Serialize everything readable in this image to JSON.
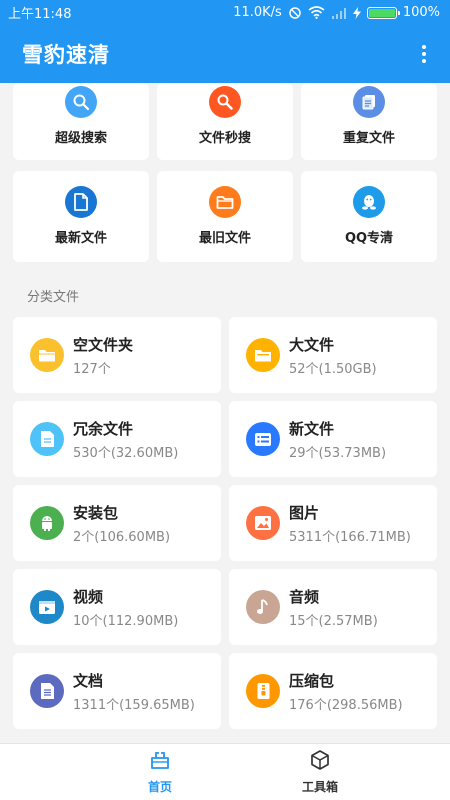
{
  "status_bar": {
    "time": "上午11:48",
    "speed": "11.0K/s",
    "battery": "100%"
  },
  "app_bar": {
    "title": "雪豹速清"
  },
  "tools": [
    {
      "label": "超级搜索",
      "icon": "search-icon",
      "color": "#42a5f5"
    },
    {
      "label": "文件秒搜",
      "icon": "magnifier-icon",
      "color": "#ff5722"
    },
    {
      "label": "重复文件",
      "icon": "duplicate-file-icon",
      "color": "#5c8ee6"
    },
    {
      "label": "最新文件",
      "icon": "file-icon",
      "color": "#1976d2"
    },
    {
      "label": "最旧文件",
      "icon": "folder-icon",
      "color": "#ff7b1c"
    },
    {
      "label": "QQ专清",
      "icon": "qq-icon",
      "color": "#1e9be9"
    }
  ],
  "section": {
    "title": "分类文件"
  },
  "categories": [
    {
      "name": "空文件夹",
      "count": "127个",
      "icon": "folder-icon",
      "color": "#fbc02d"
    },
    {
      "name": "大文件",
      "count": "52个(1.50GB)",
      "icon": "folder-icon",
      "color": "#ffb300"
    },
    {
      "name": "冗余文件",
      "count": "530个(32.60MB)",
      "icon": "document-icon",
      "color": "#4fc3f7"
    },
    {
      "name": "新文件",
      "count": "29个(53.73MB)",
      "icon": "list-file-icon",
      "color": "#2979ff"
    },
    {
      "name": "安装包",
      "count": "2个(106.60MB)",
      "icon": "android-icon",
      "color": "#4caf50"
    },
    {
      "name": "图片",
      "count": "5311个(166.71MB)",
      "icon": "image-icon",
      "color": "#ff7043"
    },
    {
      "name": "视频",
      "count": "10个(112.90MB)",
      "icon": "video-icon",
      "color": "#1e88c8"
    },
    {
      "name": "音频",
      "count": "15个(2.57MB)",
      "icon": "music-icon",
      "color": "#c9a593"
    },
    {
      "name": "文档",
      "count": "1311个(159.65MB)",
      "icon": "text-document-icon",
      "color": "#5c6bc0"
    },
    {
      "name": "压缩包",
      "count": "176个(298.56MB)",
      "icon": "zip-icon",
      "color": "#ff9800"
    }
  ],
  "bottom_nav": {
    "home": "首页",
    "toolbox": "工具箱",
    "active_color": "#2196f3",
    "inactive_color": "#333333"
  }
}
